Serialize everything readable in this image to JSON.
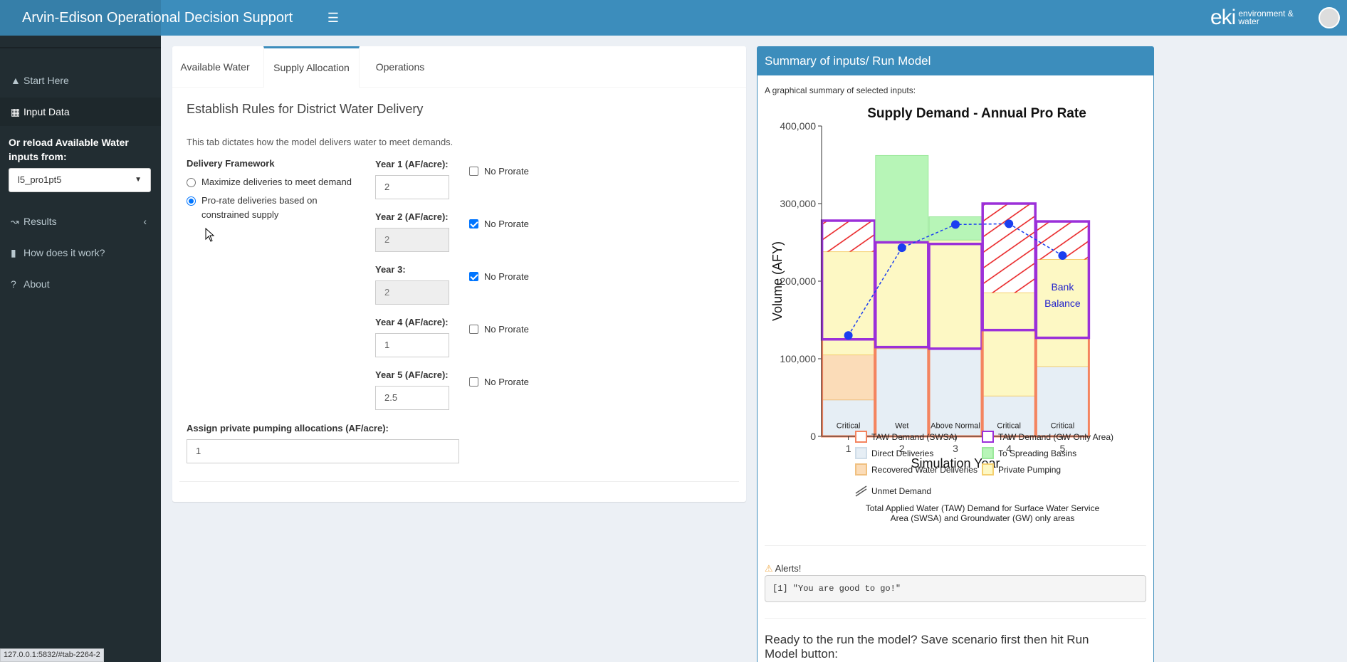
{
  "app": {
    "title": "Arvin-Edison Operational Decision Support",
    "logo_text": "eki",
    "logo_subtext": "environment & water"
  },
  "sidebar": {
    "items": [
      {
        "label": "Start Here",
        "icon": "graduation-cap-icon"
      },
      {
        "label": "Input Data",
        "icon": "table-icon"
      },
      {
        "label": "Results",
        "icon": "line-chart-icon"
      },
      {
        "label": "How does it work?",
        "icon": "book-icon"
      },
      {
        "label": "About",
        "icon": "question-icon"
      }
    ],
    "reload_label": "Or reload Available Water inputs from:",
    "reload_value": "l5_pro1pt5"
  },
  "tabs": [
    "Available Water",
    "Supply Allocation",
    "Operations"
  ],
  "pane": {
    "title": "Establish Rules for District Water Delivery",
    "description": "This tab dictates how the model delivers water to meet demands.",
    "framework_label": "Delivery Framework",
    "framework_options": [
      "Maximize deliveries to meet demand",
      "Pro-rate deliveries based on constrained supply"
    ],
    "years": [
      {
        "label": "Year 1 (AF/acre):",
        "value": "2",
        "prorate": false
      },
      {
        "label": "Year 2 (AF/acre):",
        "value": "2",
        "prorate": true
      },
      {
        "label": "Year 3:",
        "value": "2",
        "prorate": true
      },
      {
        "label": "Year 4 (AF/acre):",
        "value": "1",
        "prorate": false
      },
      {
        "label": "Year 5 (AF/acre):",
        "value": "2.5",
        "prorate": false
      }
    ],
    "no_prorate_label": "No Prorate",
    "pumping_label": "Assign private pumping allocations (AF/acre):",
    "pumping_value": "1"
  },
  "panel": {
    "title": "Summary of inputs/ Run Model",
    "summary_text": "A graphical summary of selected inputs:",
    "alerts_label": "Alerts!",
    "alerts_output": "[1] \"You are good to go!\"",
    "ready_text": "Ready to the run the model? Save scenario first then hit Run Model button:"
  },
  "status_url": "127.0.0.1:5832/#tab-2264-2",
  "chart_data": {
    "type": "bar",
    "title": "Supply Demand - Annual Pro Rate",
    "xlabel": "Simulation Year",
    "ylabel": "Volume (AFY)",
    "ylim": [
      0,
      400000
    ],
    "yticks": [
      "0",
      "100,000",
      "200,000",
      "300,000",
      "400,000"
    ],
    "categories": [
      "1",
      "2",
      "3",
      "4",
      "5"
    ],
    "year_types": [
      "Critical",
      "Wet",
      "Above Normal",
      "Critical",
      "Critical"
    ],
    "series": [
      {
        "name": "Direct Deliveries",
        "values": [
          47000,
          113000,
          112000,
          52000,
          90000
        ]
      },
      {
        "name": "Recovered Water Deliveries",
        "values": [
          58000,
          0,
          0,
          0,
          0
        ]
      },
      {
        "name": "Private Pumping",
        "values": [
          133000,
          137000,
          141000,
          133000,
          138000
        ]
      },
      {
        "name": "To Spreading Basins",
        "values": [
          0,
          112000,
          30000,
          0,
          0
        ]
      },
      {
        "name": "TAW Demand (SWSA)",
        "values": [
          125000,
          115000,
          113000,
          137000,
          127000
        ]
      },
      {
        "name": "TAW Demand (GW Only Area)",
        "values": [
          153000,
          135000,
          135000,
          163000,
          150000
        ]
      },
      {
        "name": "Bank Balance",
        "values": [
          130000,
          243000,
          273000,
          274000,
          233000
        ]
      }
    ],
    "unmet_demand_label": "Unmet Demand",
    "annotation": "Bank Balance",
    "caption": "Total Applied Water (TAW) Demand for Surface Water Service Area (SWSA) and Groundwater (GW) only areas",
    "colors": {
      "swsa": "#f4845f",
      "gw": "#9b30d9",
      "direct": "#e6eef5",
      "spreading": "#b7f5b7",
      "recovered": "#fbdcb8",
      "private": "#fdf8c4",
      "bank": "#1a3ef0",
      "unmet": "#e8181a"
    }
  }
}
